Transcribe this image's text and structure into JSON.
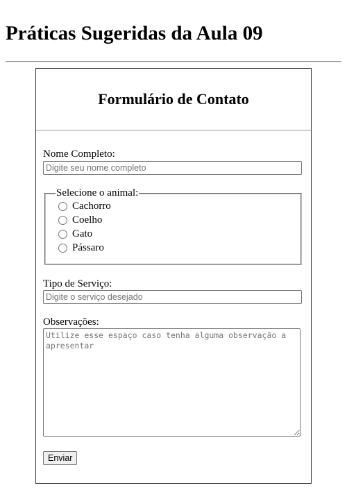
{
  "page": {
    "title": "Práticas Sugeridas da Aula 09"
  },
  "form": {
    "title": "Formulário de Contato",
    "name": {
      "label": "Nome Completo:",
      "placeholder": "Digite seu nome completo",
      "value": ""
    },
    "animal": {
      "legend": "Selecione o animal:",
      "options": [
        "Cachorro",
        "Coelho",
        "Gato",
        "Pássaro"
      ],
      "selected": null
    },
    "service": {
      "label": "Tipo de Serviço:",
      "placeholder": "Digite o serviço desejado",
      "value": ""
    },
    "notes": {
      "label": "Observações:",
      "placeholder": "Utilize esse espaço caso tenha alguma observação a apresentar",
      "value": ""
    },
    "submit_label": "Enviar"
  },
  "icons": {
    "radio": "radio-unchecked-icon",
    "resize": "resize-grip-icon"
  }
}
